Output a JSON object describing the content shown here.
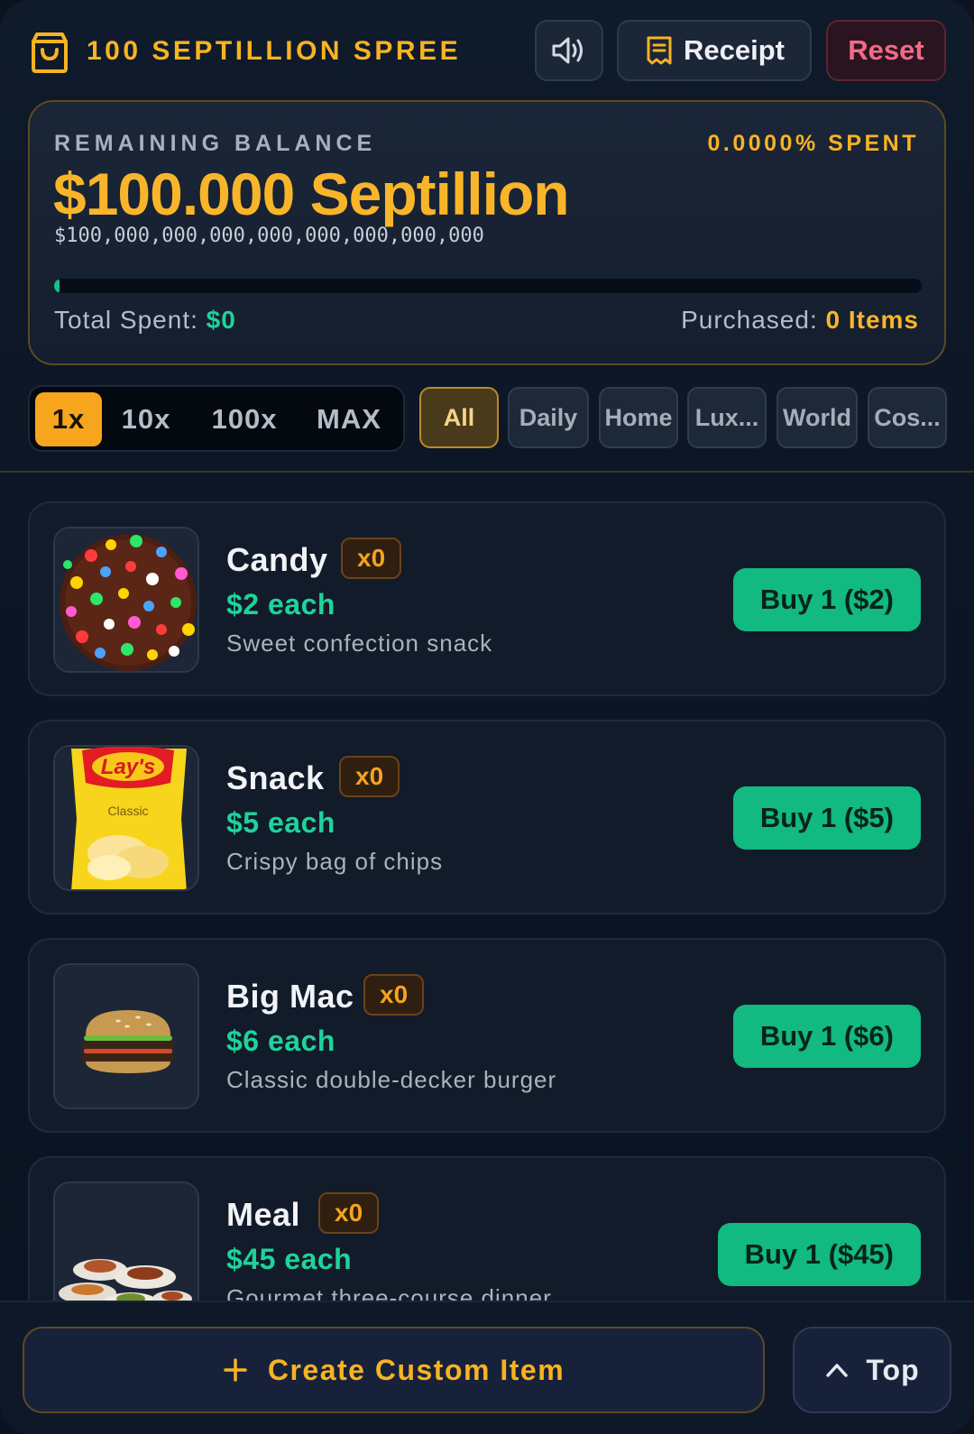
{
  "header": {
    "brand_icon": "shopping-bag-icon",
    "title": "100 SEPTILLION SPREE",
    "sound_icon": "volume-icon",
    "receipt_icon": "receipt-icon",
    "receipt_label": "Receipt",
    "reset_label": "Reset"
  },
  "balance": {
    "label": "REMAINING BALANCE",
    "spent_percent": "0.0000% SPENT",
    "amount": "$100.000 Septillion",
    "full_amount": "$100,000,000,000,000,000,000,000,000",
    "progress_fraction": 0.0,
    "total_spent_label": "Total Spent: ",
    "total_spent_value": "$0",
    "purchased_label": "Purchased: ",
    "purchased_value": "0 Items"
  },
  "multipliers": {
    "options": [
      "1x",
      "10x",
      "100x",
      "MAX"
    ],
    "selected": "1x"
  },
  "categories": {
    "options": [
      "All",
      "Daily",
      "Home",
      "Lux...",
      "World",
      "Cos..."
    ],
    "selected": "All"
  },
  "items": [
    {
      "name": "Candy",
      "qty": "x0",
      "price": "$2 each",
      "desc": "Sweet confection snack",
      "buy": "Buy 1 ($2)",
      "image": "candy-image"
    },
    {
      "name": "Snack",
      "qty": "x0",
      "price": "$5 each",
      "desc": "Crispy bag of chips",
      "buy": "Buy 1 ($5)",
      "image": "chips-bag-image",
      "brand_text": "Lay's",
      "brand_sub": "Classic"
    },
    {
      "name": "Big Mac",
      "qty": "x0",
      "price": "$6 each",
      "desc": "Classic double-decker burger",
      "buy": "Buy 1 ($6)",
      "image": "burger-image"
    },
    {
      "name": "Meal",
      "qty": "x0",
      "price": "$45 each",
      "desc": "Gourmet three-course dinner",
      "buy": "Buy 1 ($45)",
      "image": "meal-image"
    }
  ],
  "footer": {
    "create_icon": "plus-icon",
    "create_label": "Create Custom Item",
    "top_icon": "chevron-up-icon",
    "top_label": "Top"
  },
  "colors": {
    "accent": "#f7b322",
    "success": "#12b981",
    "danger": "#f26a86",
    "background": "#0b1220"
  }
}
